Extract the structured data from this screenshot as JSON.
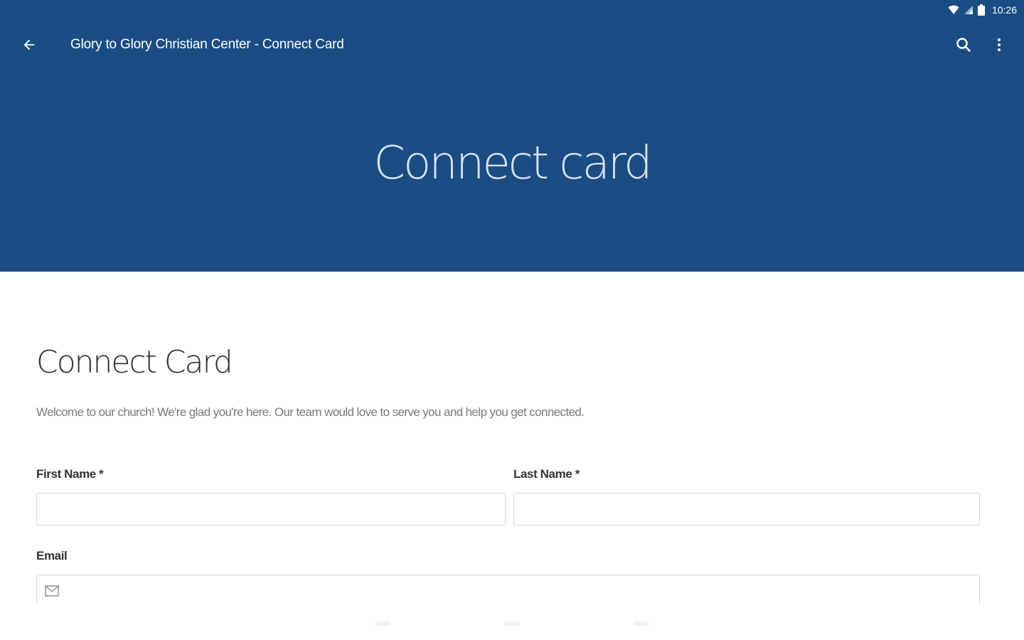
{
  "status_bar": {
    "time": "10:26",
    "icons": [
      "wifi-icon",
      "cell-signal-icon",
      "battery-icon"
    ]
  },
  "app_bar": {
    "title": "Glory to Glory Christian Center - Connect Card",
    "back_icon": "arrow-back-icon",
    "search_icon": "search-icon",
    "more_icon": "more-vertical-icon",
    "color": "#1a4d84"
  },
  "hero": {
    "title": "Connect card"
  },
  "form": {
    "title": "Connect Card",
    "intro": "Welcome to our church! We're glad you're here. Our team would love to serve you and help you get connected.",
    "first_name": {
      "label": "First Name *",
      "value": ""
    },
    "last_name": {
      "label": "Last Name *",
      "value": ""
    },
    "email": {
      "label": "Email",
      "icon": "envelope-icon",
      "value": ""
    }
  }
}
